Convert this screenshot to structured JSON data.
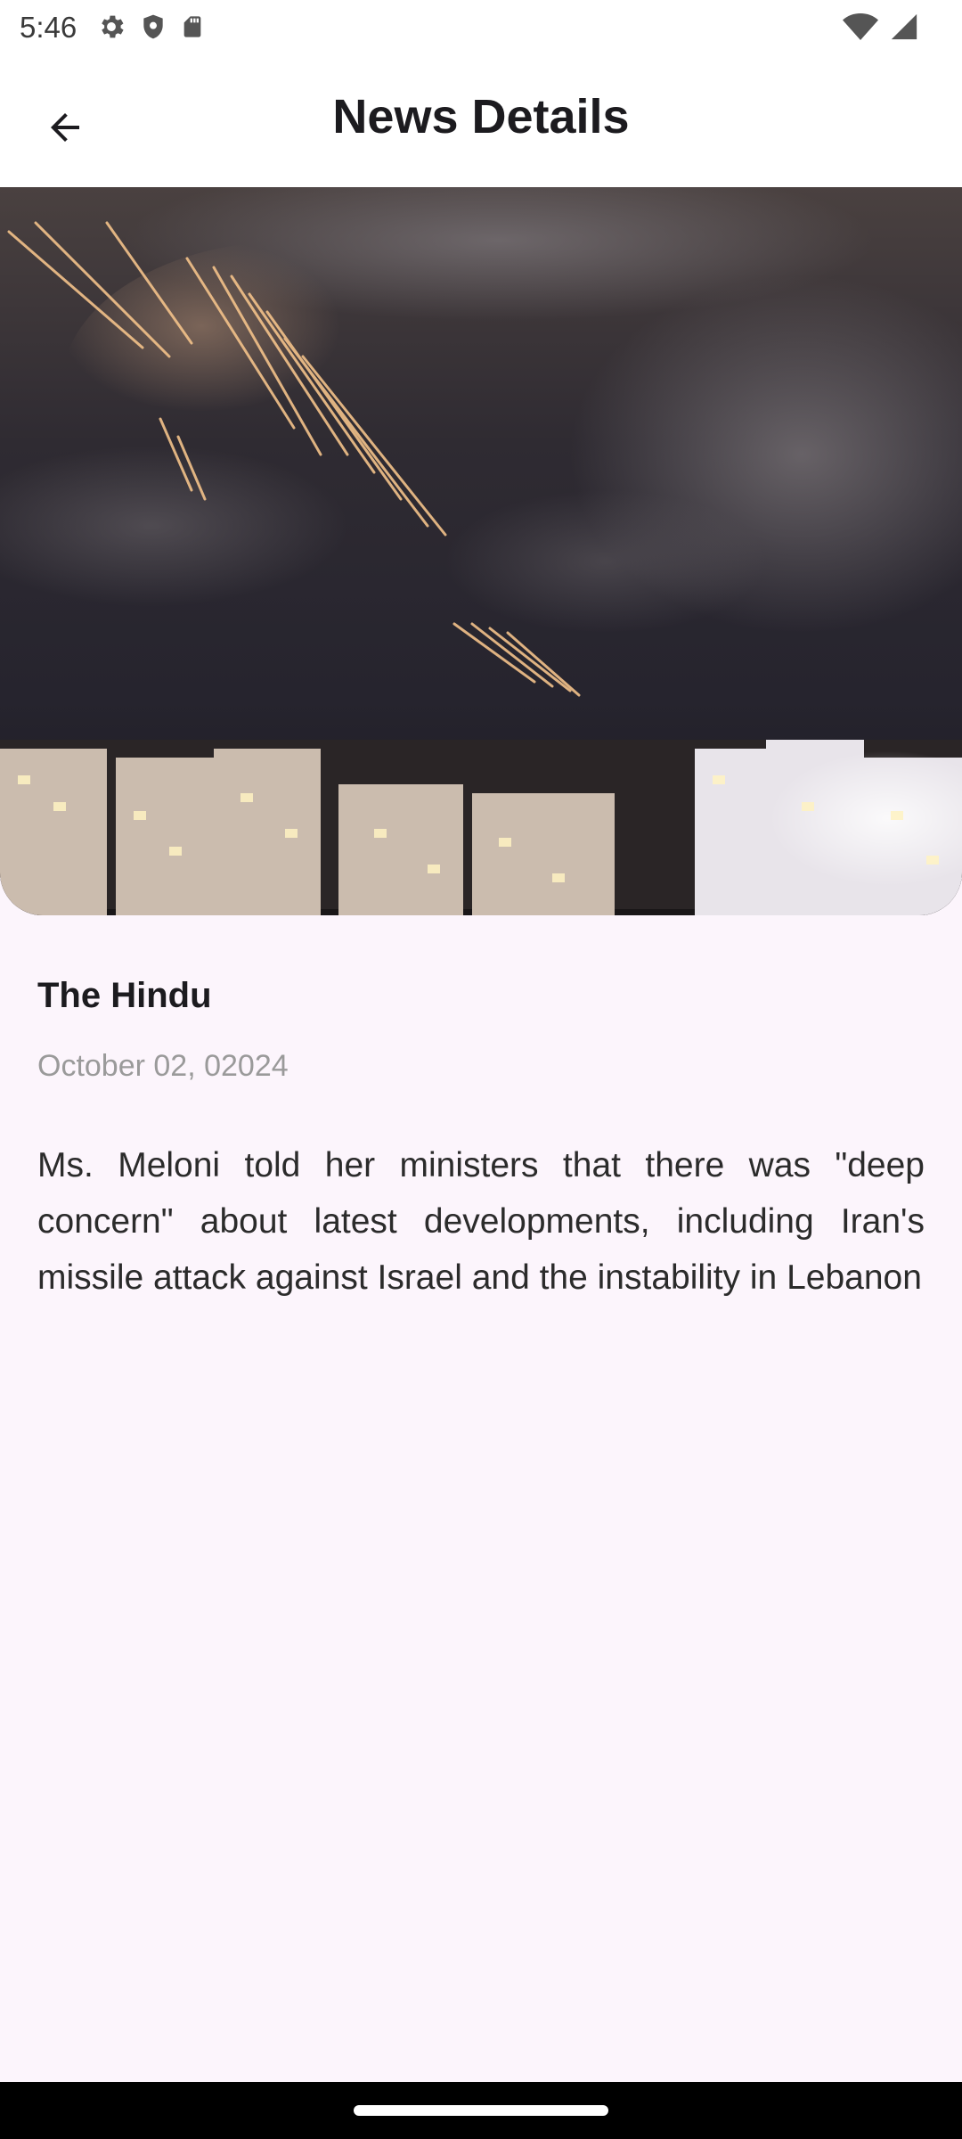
{
  "status_bar": {
    "time": "5:46",
    "left_icons": [
      "gear-icon",
      "shield-icon",
      "sd-card-icon"
    ],
    "right_icons": [
      "wifi-icon",
      "signal-icon"
    ]
  },
  "app_bar": {
    "back_icon": "arrow-back-icon",
    "title": "News Details"
  },
  "article": {
    "image_icon": "night-sky-missiles-city-photo",
    "source": "The Hindu",
    "date": "October 02, 02024",
    "body": "Ms. Meloni told her ministers that there was \"deep concern\" about latest developments, including Iran's missile attack against Israel and the instability in Lebanon"
  },
  "colors": {
    "background": "#fcf5fc",
    "app_bar": "#ffffff",
    "title_text": "#1c1b1f",
    "date_text": "#9a9a9a"
  }
}
